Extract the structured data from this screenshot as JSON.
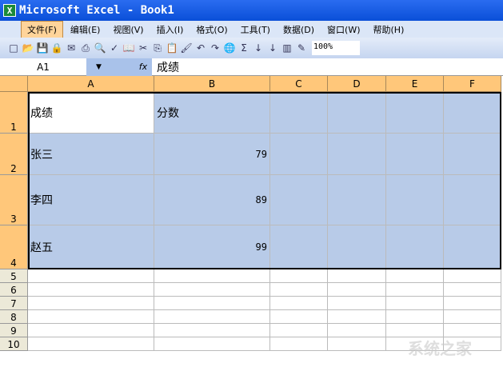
{
  "window": {
    "title": "Microsoft Excel - Book1",
    "app_icon": "excel-icon"
  },
  "menu": [
    "文件(F)",
    "编辑(E)",
    "视图(V)",
    "插入(I)",
    "格式(O)",
    "工具(T)",
    "数据(D)",
    "窗口(W)",
    "帮助(H)"
  ],
  "toolbar": {
    "icons": [
      "new",
      "open",
      "save",
      "permission",
      "email",
      "print",
      "print-preview",
      "spelling",
      "research",
      "cut",
      "copy",
      "paste",
      "format-painter",
      "undo",
      "redo",
      "hyperlink",
      "autosum",
      "sort-asc",
      "sort-desc",
      "chart",
      "drawing"
    ],
    "zoom": "100%"
  },
  "formula_bar": {
    "name_box": "A1",
    "fx": "fx",
    "value": "成绩"
  },
  "columns": [
    "A",
    "B",
    "C",
    "D",
    "E",
    "F"
  ],
  "rows": [
    {
      "n": "1",
      "a": "成绩",
      "b": "分数"
    },
    {
      "n": "2",
      "a": "张三",
      "b": "79"
    },
    {
      "n": "3",
      "a": "李四",
      "b": "89"
    },
    {
      "n": "4",
      "a": "赵五",
      "b": "99"
    },
    {
      "n": "5"
    },
    {
      "n": "6"
    },
    {
      "n": "7"
    },
    {
      "n": "8"
    },
    {
      "n": "9"
    },
    {
      "n": "10"
    }
  ],
  "watermark": "系统之家"
}
